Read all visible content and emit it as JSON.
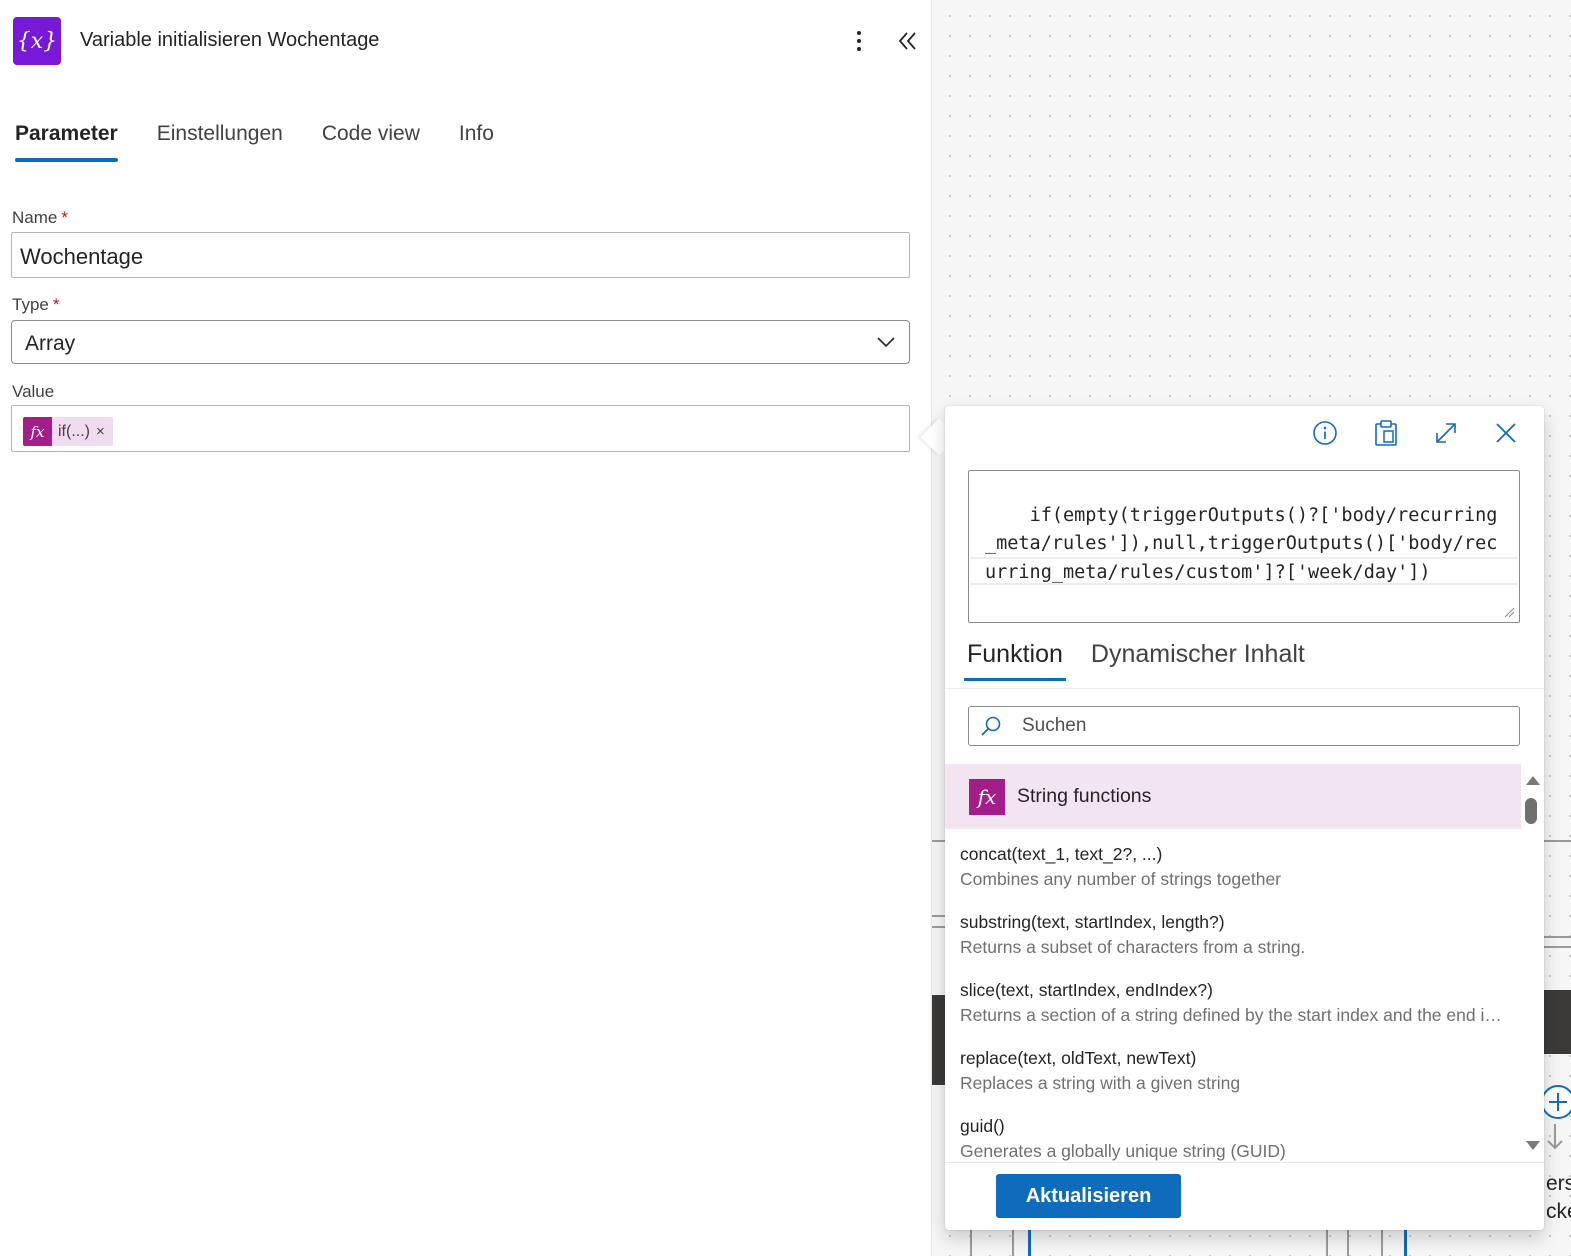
{
  "header": {
    "title": "Variable initialisieren Wochentage",
    "icon_glyph": "{x}",
    "icon_name": "variable-icon",
    "icon_color": "#7719d6"
  },
  "tabs": [
    {
      "label": "Parameter",
      "active": true
    },
    {
      "label": "Einstellungen",
      "active": false
    },
    {
      "label": "Code view",
      "active": false
    },
    {
      "label": "Info",
      "active": false
    }
  ],
  "form": {
    "name": {
      "label": "Name",
      "required_mark": "*",
      "value": "Wochentage"
    },
    "type": {
      "label": "Type",
      "required_mark": "*",
      "value": "Array"
    },
    "value": {
      "label": "Value",
      "token_icon": "fx",
      "token_text": "if(...)",
      "token_remove": "×"
    }
  },
  "editor": {
    "expression": "if(empty(triggerOutputs()?['body/recurring_meta/rules']),null,triggerOutputs()['body/recurring_meta/rules/custom']?['week/day'])",
    "tabs": [
      {
        "label": "Funktion",
        "active": true
      },
      {
        "label": "Dynamischer Inhalt",
        "active": false
      }
    ],
    "search_placeholder": "Suchen",
    "category": {
      "icon": "fx",
      "label": "String functions"
    },
    "functions": [
      {
        "name": "concat(text_1, text_2?, ...)",
        "description": "Combines any number of strings together"
      },
      {
        "name": "substring(text, startIndex, length?)",
        "description": "Returns a subset of characters from a string."
      },
      {
        "name": "slice(text, startIndex, endIndex?)",
        "description": "Returns a section of a string defined by the start index and the end index"
      },
      {
        "name": "replace(text, oldText, newText)",
        "description": "Replaces a string with a given string"
      },
      {
        "name": "guid()",
        "description": "Generates a globally unique string (GUID)"
      }
    ],
    "update_button": "Aktualisieren"
  },
  "canvas": {
    "partial_text_1": "ers",
    "partial_text_2": "cke"
  },
  "colors": {
    "accent": "#0f6cbd",
    "function_magenta": "#a31e89",
    "category_bg": "#f3e4f2"
  }
}
